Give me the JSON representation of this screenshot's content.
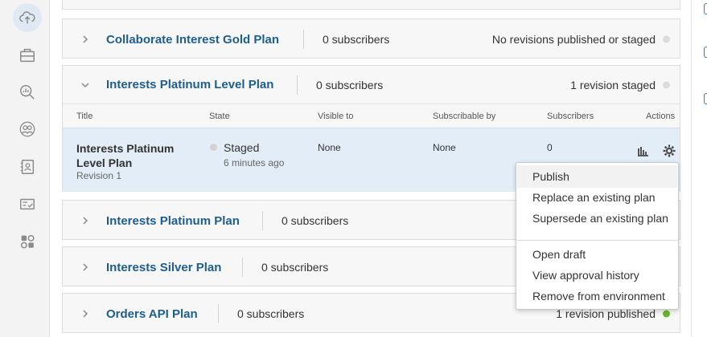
{
  "nav": {
    "icons": [
      "cloud-upload-icon",
      "toolbox-icon",
      "analytics-search-icon",
      "users-icon",
      "contacts-icon",
      "approved-card-icon",
      "apps-settings-icon"
    ]
  },
  "plans": [
    {
      "name": "Collaborate Interest Gold Plan",
      "subscribers": "0 subscribers",
      "status": "No revisions published or staged",
      "dot": "#dcdcdc"
    },
    {
      "name": "Interests Platinum Level Plan",
      "subscribers": "0 subscribers",
      "status": "1 revision staged",
      "dot": "#dcdcdc"
    },
    {
      "name": "Interests Platinum Plan",
      "subscribers": "0 subscribers",
      "status": "",
      "dot": ""
    },
    {
      "name": "Interests Silver Plan",
      "subscribers": "0 subscribers",
      "status": "",
      "dot": ""
    },
    {
      "name": "Orders API Plan",
      "subscribers": "0 subscribers",
      "status": "1 revision published",
      "dot": "#6ab52e"
    }
  ],
  "table": {
    "headers": {
      "title": "Title",
      "state": "State",
      "visible": "Visible to",
      "subscribable": "Subscribable by",
      "subscribers": "Subscribers",
      "actions": "Actions"
    },
    "row": {
      "title": "Interests Platinum Level Plan",
      "revision": "Revision 1",
      "state": "Staged",
      "state_time": "6 minutes ago",
      "visible": "None",
      "subscribable": "None",
      "subscribers": "0"
    }
  },
  "menu": {
    "publish": "Publish",
    "replace": "Replace an existing plan",
    "supersede": "Supersede an existing plan",
    "open_draft": "Open draft",
    "history": "View approval history",
    "remove": "Remove from environment"
  }
}
